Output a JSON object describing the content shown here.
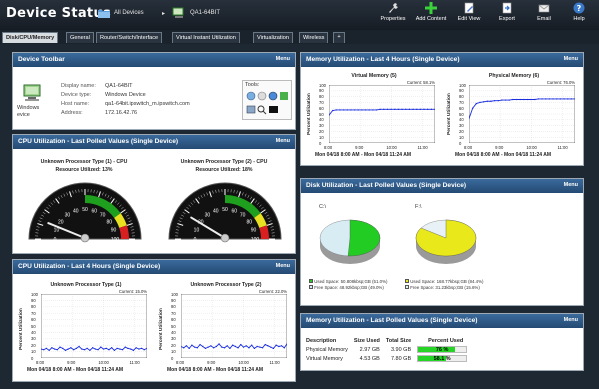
{
  "header": {
    "title": "Device Status",
    "breadcrumb_root": "All Devices",
    "breadcrumb_device": "QA1-64BIT"
  },
  "toolbar": {
    "properties": "Properties",
    "add_content": "Add Content",
    "edit_view": "Edit View",
    "export": "Export",
    "email": "Email",
    "help": "Help"
  },
  "tabs": [
    "Disk/CPU/Memory",
    "General",
    "Router/Switch/Interface",
    "Virtual Instant Utilization",
    "Virtualization",
    "Wireless",
    "+"
  ],
  "menu_label": "Menu",
  "device_toolbar": {
    "title": "Device Toolbar",
    "icon_caption_1": "Windows",
    "icon_caption_2": "evice",
    "fields": [
      {
        "label": "Display name:",
        "value": "QA1-64BIT"
      },
      {
        "label": "Device type:",
        "value": "Windows Device"
      },
      {
        "label": "Host name:",
        "value": "qa1-64bit.ipswitch_m.ipswitch.com"
      },
      {
        "label": "Address:",
        "value": "172.16.42.76"
      }
    ],
    "tools_label": "Tools:"
  },
  "cpu_polled": {
    "title": "CPU Utilization - Last Polled Values (Single Device)",
    "gauges": [
      {
        "line1": "Unknown Processor Type (1) - CPU",
        "line2": "Resource Utilized: 13%",
        "value": 13
      },
      {
        "line1": "Unknown Processor Type (2) - CPU",
        "line2": "Resource Utilized: 18%",
        "value": 18
      }
    ],
    "ticks": [
      "0",
      "10",
      "20",
      "30",
      "40",
      "50",
      "60",
      "70",
      "80",
      "90",
      "100"
    ]
  },
  "cpu_4h": {
    "title": "CPU Utilization - Last 4 Hours (Single Device)",
    "ylabel": "Percent Utilization",
    "xlabel": "Mon 04/18 8:00 AM - Mon 04/18 11:24 AM",
    "x_ticks": [
      "8:00",
      "9:00",
      "10:00",
      "11:00"
    ],
    "y_ticks": [
      "100",
      "90",
      "80",
      "70",
      "60",
      "50",
      "40",
      "30",
      "20",
      "10",
      "0"
    ]
  },
  "mem_4h": {
    "title": "Memory Utilization - Last 4 Hours (Single Device)",
    "ylabel": "Percent Utilization",
    "xlabel": "Mon 04/18 8:00 AM - Mon 04/18 11:24 AM",
    "x_ticks": [
      "8:00",
      "9:00",
      "10:00",
      "11:00"
    ],
    "y_ticks": [
      "100",
      "90",
      "80",
      "70",
      "60",
      "50",
      "40",
      "30",
      "20",
      "10",
      "0"
    ]
  },
  "disk": {
    "title": "Disk Utilization - Last Polled Values (Single Device)",
    "disks": [
      {
        "name": "C:\\",
        "used_pct": 51.0,
        "used_text": "Used Space: 50.808kbsp;GB (51.0%)",
        "free_text": "Free Space: 48.92kbsp;GB (49.0%)"
      },
      {
        "name": "F:\\",
        "used_pct": 84.4,
        "used_text": "Used Space: 168.77kbsp;GB (84.4%)",
        "free_text": "Free Space: 31.23kbsp;GB (15.6%)"
      }
    ],
    "colors": {
      "c_used": "#22cc22",
      "c_free": "#d8ecf4",
      "f_used": "#e8e81a",
      "f_free": "#e8f2f6"
    }
  },
  "mem_polled": {
    "title": "Memory Utilization - Last Polled Values (Single Device)",
    "headers": [
      "Description",
      "Size Used",
      "Total Size",
      "Percent Used"
    ],
    "rows": [
      {
        "desc": "Physical Memory",
        "used": "2.97 GB",
        "total": "3.90 GB",
        "pct_text": "76 %",
        "pct": 76
      },
      {
        "desc": "Virtual Memory",
        "used": "4.53 GB",
        "total": "7.80 GB",
        "pct_text": "58.1 %",
        "pct": 58.1
      }
    ]
  },
  "chart_data": [
    {
      "type": "line",
      "title": "Unknown Processor Type (1)",
      "current": "Current: 15.0%",
      "ylim": [
        0,
        100
      ],
      "x": [
        "8:00",
        "9:00",
        "10:00",
        "11:00",
        "11:24"
      ],
      "series": [
        {
          "values": [
            14,
            13,
            15,
            12,
            16,
            14,
            13,
            17,
            15,
            12,
            14,
            16,
            13,
            15,
            18,
            14,
            13,
            15,
            12,
            16,
            14,
            13,
            17,
            14,
            15,
            13,
            16,
            12,
            15,
            14,
            13,
            17,
            15,
            14,
            12,
            16,
            14,
            15,
            13,
            15
          ]
        }
      ]
    },
    {
      "type": "line",
      "title": "Unknown Processor Type (2)",
      "current": "Current: 22.0%",
      "ylim": [
        0,
        100
      ],
      "x": [
        "8:00",
        "9:00",
        "10:00",
        "11:00",
        "11:24"
      ],
      "series": [
        {
          "values": [
            18,
            16,
            19,
            15,
            20,
            17,
            16,
            21,
            18,
            15,
            17,
            19,
            16,
            18,
            22,
            17,
            16,
            19,
            15,
            20,
            18,
            16,
            21,
            17,
            19,
            16,
            20,
            15,
            18,
            17,
            16,
            21,
            19,
            17,
            15,
            20,
            18,
            19,
            16,
            22
          ]
        }
      ]
    },
    {
      "type": "line",
      "title": "Virtual Memory (5)",
      "current": "Current: 58.1%",
      "ylim": [
        0,
        100
      ],
      "x": [
        "8:00",
        "9:00",
        "10:00",
        "11:00",
        "11:24"
      ],
      "series": [
        {
          "values": [
            48,
            56,
            57,
            57,
            57,
            57,
            57,
            57,
            57,
            57,
            57,
            57,
            57,
            57,
            58,
            58,
            58,
            58,
            58,
            58,
            58,
            58,
            58,
            58,
            58,
            58,
            58,
            58,
            58,
            58
          ]
        }
      ]
    },
    {
      "type": "line",
      "title": "Physical Memory (6)",
      "current": "Current: 76.0%",
      "ylim": [
        0,
        100
      ],
      "x": [
        "8:00",
        "9:00",
        "10:00",
        "11:00",
        "11:24"
      ],
      "series": [
        {
          "values": [
            42,
            60,
            68,
            70,
            71,
            72,
            72,
            73,
            73,
            74,
            74,
            74,
            75,
            75,
            75,
            75,
            75,
            75,
            75,
            76,
            76,
            76,
            76,
            76,
            76,
            76,
            76,
            76,
            76,
            76
          ]
        }
      ]
    }
  ]
}
